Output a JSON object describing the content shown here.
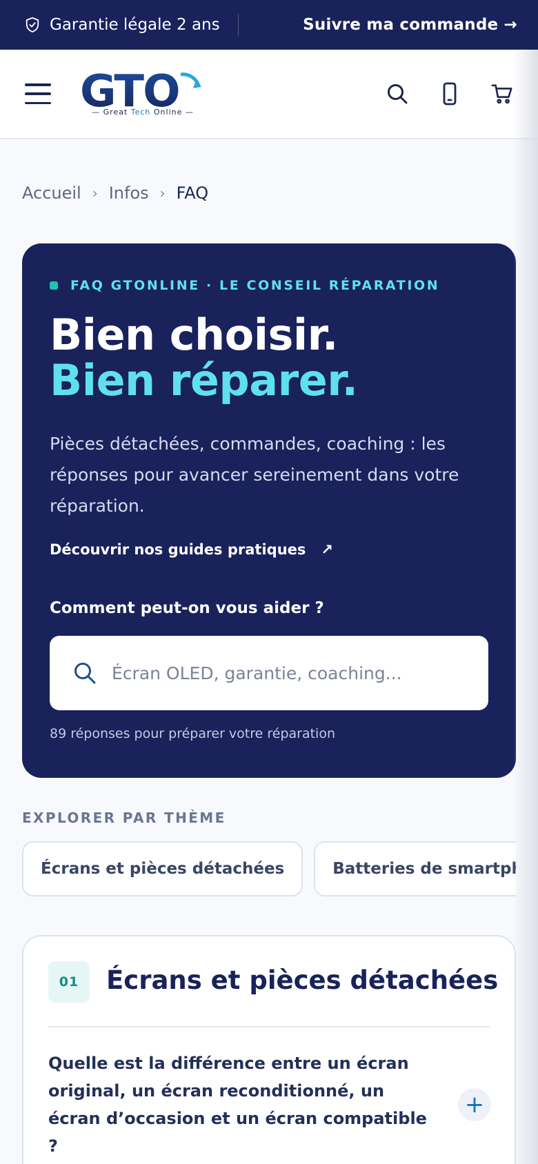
{
  "topbar": {
    "guarantee": "Garantie légale 2 ans",
    "track": "Suivre ma commande →"
  },
  "header": {
    "logo_text": "GTO",
    "logo_tag_pre": "— Great ",
    "logo_tag_tech": "Tech",
    "logo_tag_post": " Online —",
    "icons": [
      "menu-icon",
      "search-icon",
      "phone-icon",
      "cart-icon"
    ]
  },
  "breadcrumb": {
    "items": [
      "Accueil",
      "Infos",
      "FAQ"
    ],
    "separator": "›"
  },
  "hero": {
    "eyebrow": "FAQ GTONLINE · LE CONSEIL RÉPARATION",
    "title_line1": "Bien choisir.",
    "title_line2": "Bien réparer.",
    "lead": "Pièces détachées, commandes, coaching : les réponses pour avancer sereinement dans votre réparation.",
    "guides_link": "Découvrir nos guides pratiques",
    "guides_arrow": "↗",
    "help_label": "Comment peut-on vous aider ?",
    "search_placeholder": "Écran OLED, garantie, coaching...",
    "count_text": "89 réponses pour préparer votre réparation"
  },
  "themes": {
    "label": "EXPLORER PAR THÈME",
    "chips": [
      "Écrans et pièces détachées",
      "Batteries de smartphones"
    ]
  },
  "faq_section": {
    "number": "01",
    "title": "Écrans et pièces détachées",
    "question": "Quelle est la différence entre un écran original, un écran reconditionné, un écran d’occasion et un écran compatible ?",
    "toggle": "+"
  },
  "colors": {
    "navy": "#19225a",
    "cyan": "#5fe1ed",
    "teal": "#1ec3b2",
    "blue": "#1b6fc4"
  }
}
